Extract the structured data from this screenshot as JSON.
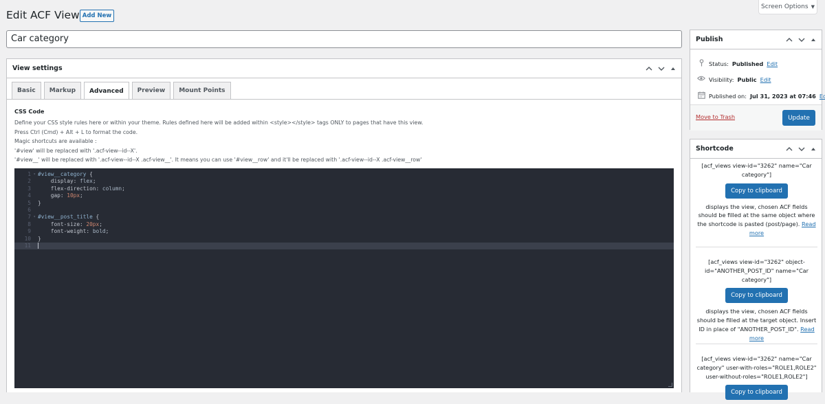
{
  "screen_options": {
    "label": "Screen Options",
    "caret": "▼"
  },
  "header": {
    "title": "Edit ACF View",
    "add_new": "Add New"
  },
  "title_field": {
    "value": "Car category"
  },
  "view_settings": {
    "title": "View settings",
    "tabs": [
      "Basic",
      "Markup",
      "Advanced",
      "Preview",
      "Mount Points"
    ],
    "active_tab": "Advanced",
    "field_label": "CSS Code",
    "description": [
      "Define your CSS style rules here or within your theme. Rules defined here will be added within <style></style> tags ONLY to pages that have this view.",
      "Press Ctrl (Cmd) + Alt + L to format the code.",
      "Magic shortcuts are available :",
      "'#view' will be replaced with '.acf-view--id--X'.",
      "'#view__' will be replaced with '.acf-view--id--X .acf-view__'. It means you can use '#view__row' and it'll be replaced with '.acf-view--id--X .acf-view__row'"
    ],
    "code_lines": [
      "#view__category {",
      "    display: flex;",
      "    flex-direction: column;",
      "    gap: 10px;",
      "}",
      "",
      "#view__post_title {",
      "    font-size: 20px;",
      "    font-weight: bold;",
      "}",
      ""
    ]
  },
  "publish": {
    "title": "Publish",
    "status_label": "Status:",
    "status_value": "Published",
    "visibility_label": "Visibility:",
    "visibility_value": "Public",
    "published_label": "Published on:",
    "published_value": "Jul 31, 2023 at 07:46",
    "edit": "Edit",
    "trash": "Move to Trash",
    "update": "Update"
  },
  "shortcode": {
    "title": "Shortcode",
    "copy_label": "Copy to clipboard",
    "blocks": [
      {
        "code": "[acf_views view-id=\"3262\" name=\"Car category\"]",
        "desc": "displays the view, chosen ACF fields should be filled at the same object where the shortcode is pasted (post/page).",
        "link": "Read more"
      },
      {
        "code": "[acf_views view-id=\"3262\" object-id=\"ANOTHER_POST_ID\" name=\"Car category\"]",
        "desc": "displays the view, chosen ACF fields should be filled at the target object. Insert ID in place of \"ANOTHER_POST_ID\".",
        "link": "Read more"
      },
      {
        "code": "[acf_views view-id=\"3262\" name=\"Car category\" user-with-roles=\"ROLE1,ROLE2\" user-without-roles=\"ROLE1,ROLE2\"]"
      }
    ]
  },
  "colors": {
    "accent": "#2271b1",
    "editor_bg": "#272b34",
    "danger": "#b32d2e"
  }
}
